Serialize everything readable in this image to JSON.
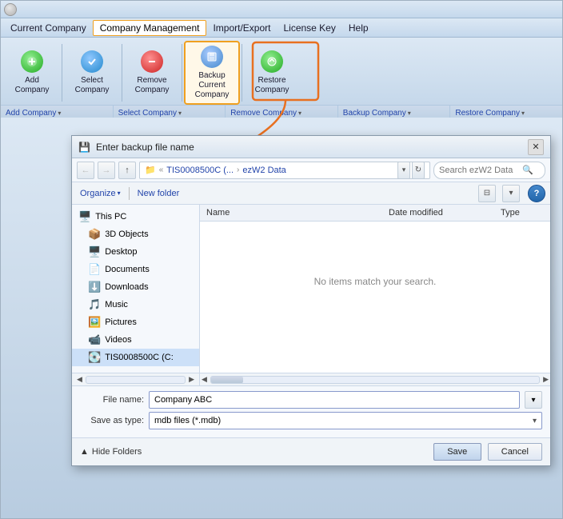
{
  "app": {
    "title": "",
    "menu": {
      "items": [
        {
          "id": "current-company",
          "label": "Current Company"
        },
        {
          "id": "company-management",
          "label": "Company Management",
          "active": true
        },
        {
          "id": "import-export",
          "label": "Import/Export"
        },
        {
          "id": "license-key",
          "label": "License Key"
        },
        {
          "id": "help",
          "label": "Help"
        }
      ]
    },
    "ribbon": {
      "buttons": [
        {
          "id": "add-company",
          "label": "Add\nCompany",
          "icon": "plus",
          "icon_style": "green"
        },
        {
          "id": "select-company",
          "label": "Select\nCompany",
          "icon": "check",
          "icon_style": "blue"
        },
        {
          "id": "remove-company",
          "label": "Remove\nCompany",
          "icon": "minus",
          "icon_style": "red"
        },
        {
          "id": "backup-current-company",
          "label": "Backup\nCurrent\nCompany",
          "icon": "save",
          "icon_style": "save",
          "highlighted": true
        },
        {
          "id": "restore-company",
          "label": "Restore\nCompany",
          "icon": "restore",
          "icon_style": "restore"
        }
      ],
      "footer_items": [
        {
          "id": "add-company-footer",
          "label": "Add Company"
        },
        {
          "id": "select-company-footer",
          "label": "Select Company"
        },
        {
          "id": "remove-company-footer",
          "label": "Remove Company"
        },
        {
          "id": "backup-company-footer",
          "label": "Backup Company"
        },
        {
          "id": "restore-company-footer",
          "label": "Restore Company"
        }
      ]
    }
  },
  "dialog": {
    "title": "Enter backup file name",
    "icon": "💾",
    "nav": {
      "back_disabled": true,
      "forward_disabled": true,
      "up_label": "Up",
      "path": "TIS0008500C (... > ezW2 Data",
      "path_parts": [
        "TIS0008500C (...",
        "ezW2 Data"
      ],
      "search_placeholder": "Search ezW2 Data"
    },
    "toolbar": {
      "organize_label": "Organize",
      "new_folder_label": "New folder"
    },
    "tree": {
      "items": [
        {
          "id": "this-pc",
          "label": "This PC",
          "icon": "🖥️",
          "indent": 0
        },
        {
          "id": "3d-objects",
          "label": "3D Objects",
          "icon": "📦",
          "indent": 1
        },
        {
          "id": "desktop",
          "label": "Desktop",
          "icon": "🖥️",
          "indent": 1
        },
        {
          "id": "documents",
          "label": "Documents",
          "icon": "📄",
          "indent": 1
        },
        {
          "id": "downloads",
          "label": "Downloads",
          "icon": "⬇️",
          "indent": 1
        },
        {
          "id": "music",
          "label": "Music",
          "icon": "🎵",
          "indent": 1
        },
        {
          "id": "pictures",
          "label": "Pictures",
          "icon": "🖼️",
          "indent": 1
        },
        {
          "id": "videos",
          "label": "Videos",
          "icon": "📹",
          "indent": 1
        },
        {
          "id": "tis0008500c",
          "label": "TIS0008500C (C:",
          "icon": "💽",
          "indent": 1,
          "selected": true
        }
      ]
    },
    "file_area": {
      "columns": [
        "Name",
        "Date modified",
        "Type"
      ],
      "empty_message": "No items match your search."
    },
    "form": {
      "filename_label": "File name:",
      "filename_value": "Company ABC",
      "saveastype_label": "Save as type:",
      "saveastype_value": "mdb files (*.mdb)"
    },
    "footer": {
      "hide_folders_label": "Hide Folders",
      "save_label": "Save",
      "cancel_label": "Cancel"
    }
  }
}
